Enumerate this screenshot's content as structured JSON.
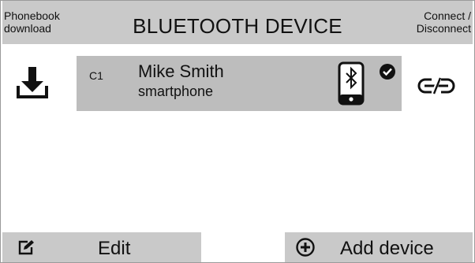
{
  "header": {
    "left_label": "Phonebook\ndownload",
    "title": "BLUETOOTH DEVICE",
    "right_label": "Connect /\nDisconnect"
  },
  "device": {
    "slot": "C1",
    "name": "Mike Smith",
    "type": "smartphone",
    "icons": [
      "download-icon",
      "bluetooth-phone-icon",
      "check-icon",
      "unlink-icon"
    ]
  },
  "footer": {
    "edit_label": "Edit",
    "add_label": "Add device",
    "icons": [
      "edit-icon",
      "plus-circle-icon"
    ]
  },
  "colors": {
    "header_bg": "#c9c9c9",
    "row_bg": "#bdbdbd",
    "text": "#111111"
  }
}
